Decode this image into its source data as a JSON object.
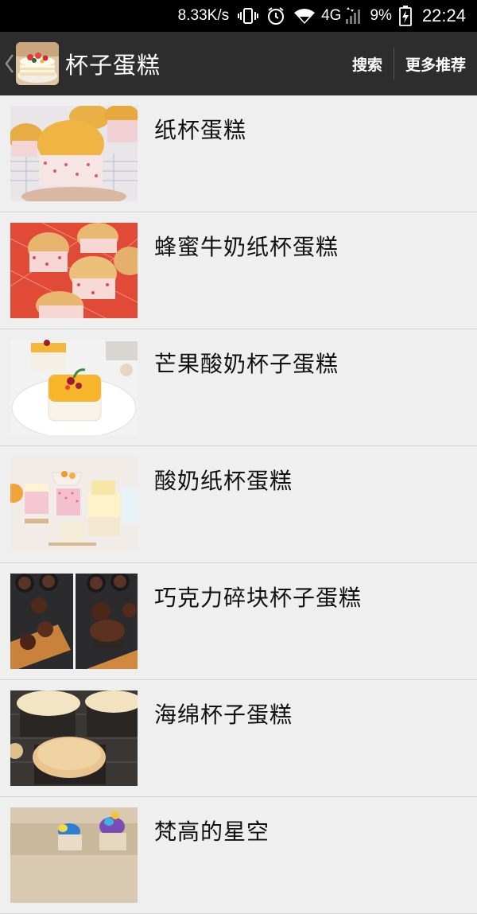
{
  "status_bar": {
    "net_speed": "8.33K/s",
    "network": "4G",
    "battery": "9%",
    "time": "22:24",
    "icons": [
      "vibrate-icon",
      "alarm-icon",
      "wifi-icon",
      "signal-icon",
      "battery-charging-icon"
    ]
  },
  "app_bar": {
    "title": "杯子蛋糕",
    "search_label": "搜索",
    "more_label": "更多推荐"
  },
  "recipes": [
    {
      "title": "纸杯蛋糕"
    },
    {
      "title": "蜂蜜牛奶纸杯蛋糕"
    },
    {
      "title": "芒果酸奶杯子蛋糕"
    },
    {
      "title": "酸奶纸杯蛋糕"
    },
    {
      "title": "巧克力碎块杯子蛋糕"
    },
    {
      "title": "海绵杯子蛋糕"
    },
    {
      "title": "梵高的星空"
    }
  ]
}
